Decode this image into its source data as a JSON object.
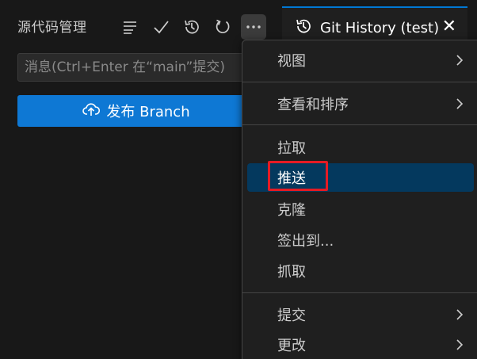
{
  "scm": {
    "title": "源代码管理",
    "message_placeholder": "消息(Ctrl+Enter 在“main”提交)",
    "publish_label": "发布 Branch"
  },
  "toolbar": {
    "icons": [
      "list-icon",
      "check-icon",
      "history-icon",
      "refresh-icon",
      "more-icon"
    ]
  },
  "tab": {
    "label": "Git History (test)",
    "close": "✕"
  },
  "menu": {
    "items": [
      {
        "label": "视图",
        "submenu": true
      },
      {
        "label": "查看和排序",
        "submenu": true
      },
      {
        "label": "拉取",
        "submenu": false
      },
      {
        "label": "推送",
        "submenu": false,
        "selected": true
      },
      {
        "label": "克隆",
        "submenu": false
      },
      {
        "label": "签出到...",
        "submenu": false
      },
      {
        "label": "抓取",
        "submenu": false
      },
      {
        "label": "提交",
        "submenu": true
      },
      {
        "label": "更改",
        "submenu": true
      }
    ]
  },
  "colors": {
    "accent": "#0e78d4",
    "selected_bg": "#04395e",
    "highlight_border": "#e51b24",
    "background": "#181818"
  }
}
